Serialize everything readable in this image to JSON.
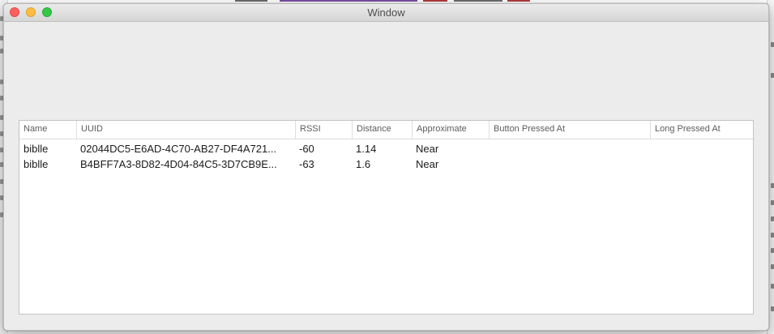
{
  "window": {
    "title": "Window"
  },
  "table": {
    "columns": [
      "Name",
      "UUID",
      "RSSI",
      "Distance",
      "Approximate",
      "Button Pressed At",
      "Long Pressed At"
    ],
    "rows": [
      [
        "biblle",
        "02044DC5-E6AD-4C70-AB27-DF4A721...",
        "-60",
        "1.14",
        "Near",
        "",
        ""
      ],
      [
        "biblle",
        "B4BFF7A3-8D82-4D04-84C5-3D7CB9E...",
        "-63",
        "1.6",
        "Near",
        "",
        ""
      ]
    ]
  },
  "colors": {
    "close": "#fc605c",
    "minimize": "#fdbc40",
    "zoom": "#34c84a",
    "window_bg": "#ececec",
    "table_bg": "#ffffff"
  }
}
